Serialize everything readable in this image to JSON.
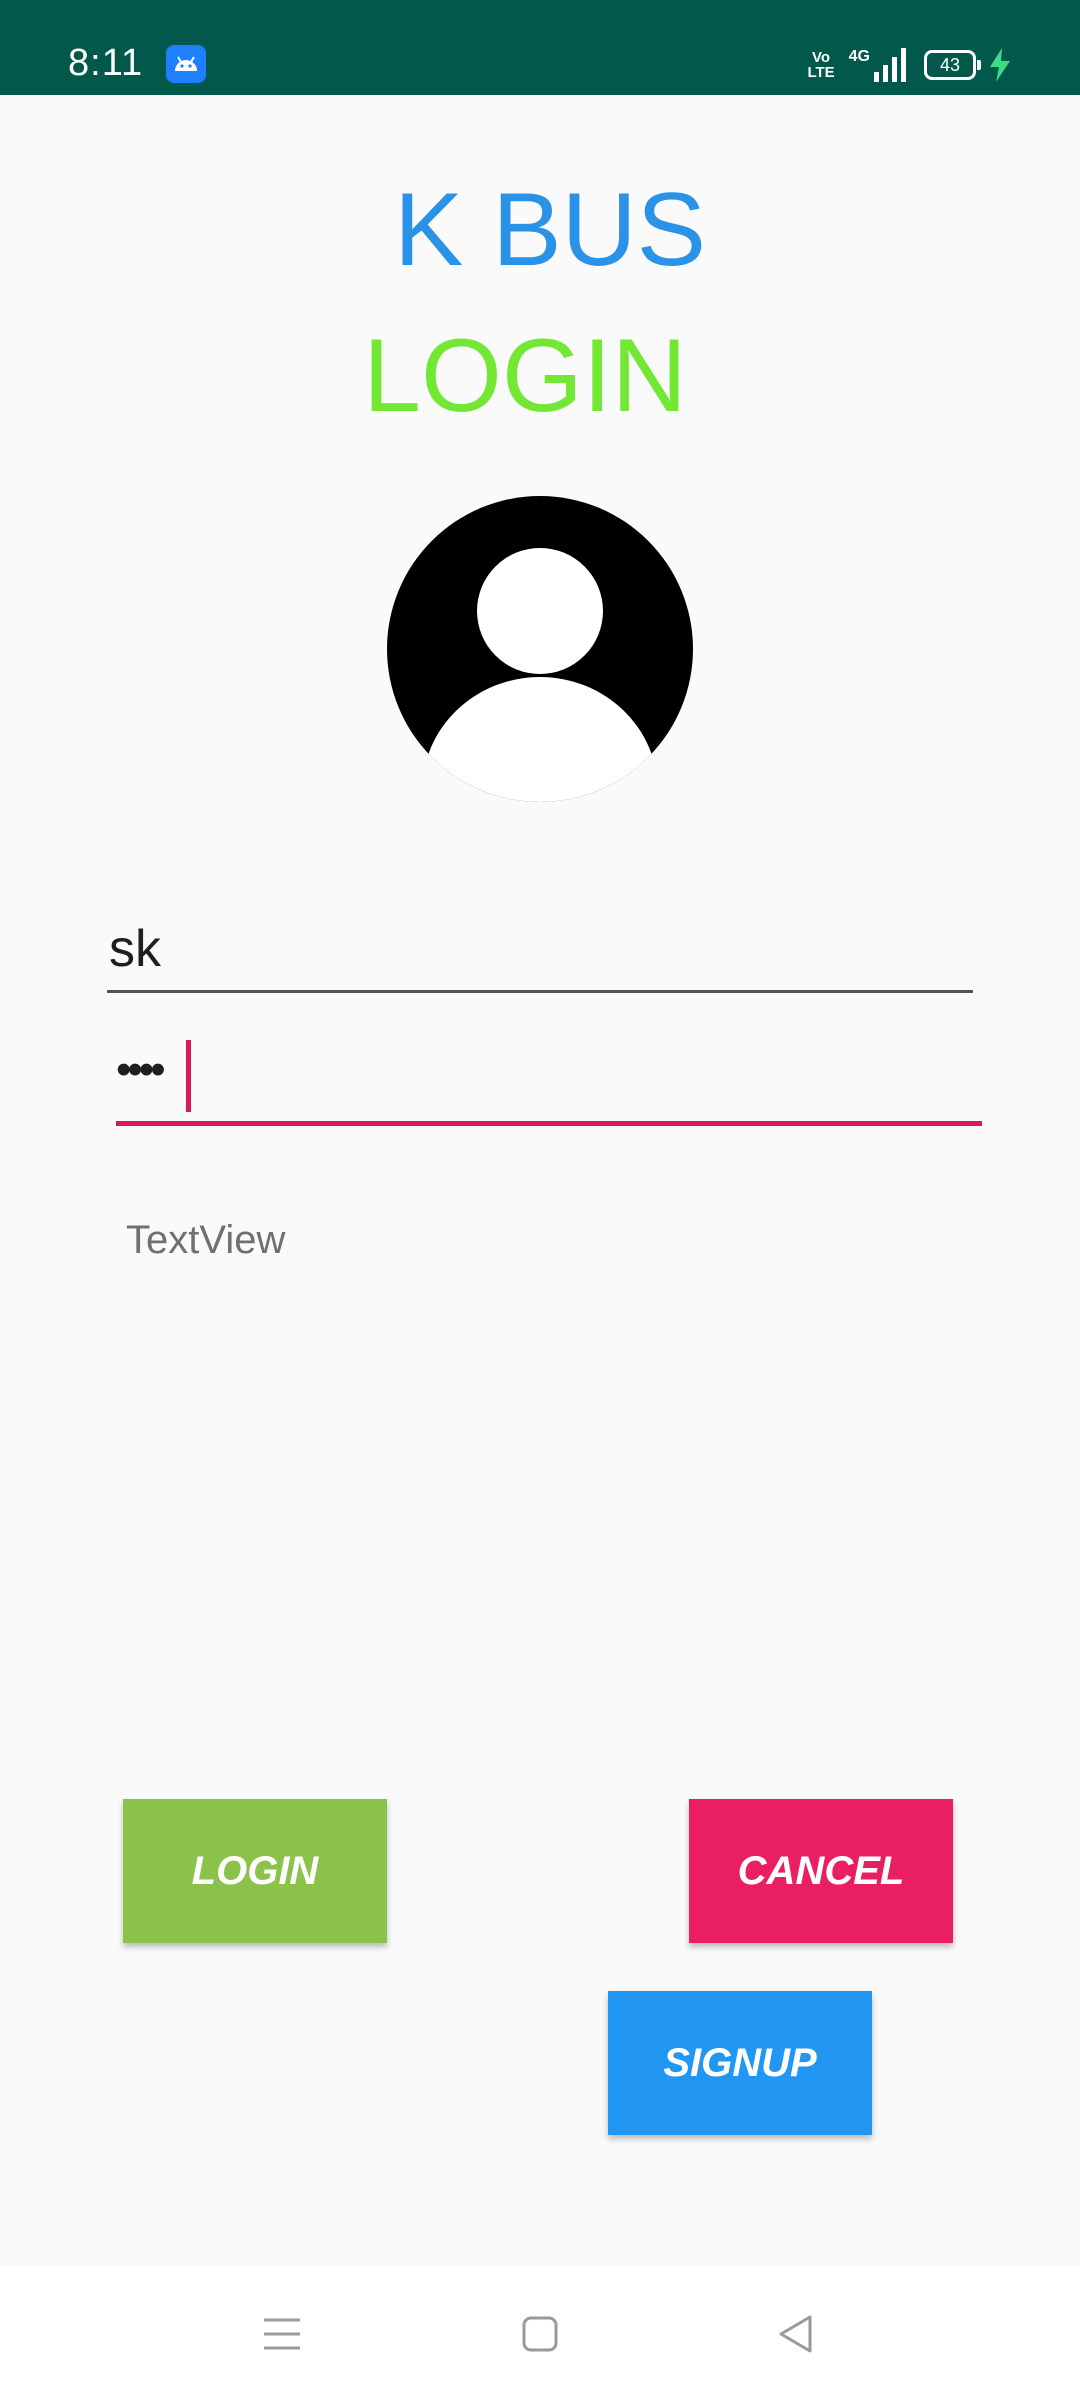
{
  "status_bar": {
    "time": "8:11",
    "volte_top": "Vo",
    "volte_bottom": "LTE",
    "network": "4G",
    "battery": "43",
    "app_icon": "android-icon",
    "signal_icon": "signal-icon",
    "charging_icon": "lightning-icon",
    "bg_color": "#02594B"
  },
  "header": {
    "app_title": "K BUS",
    "screen_title": "LOGIN",
    "title_color": "#2A93E8",
    "subtitle_color": "#72E835"
  },
  "avatar": {
    "icon": "user-avatar-icon"
  },
  "form": {
    "username_value": "sk",
    "password_value": "••••",
    "focus_color": "#D81B60",
    "message": "TextView"
  },
  "buttons": {
    "login": "LOGIN",
    "cancel": "CANCEL",
    "signup": "SIGNUP",
    "login_color": "#8BC34A",
    "cancel_color": "#E91E63",
    "signup_color": "#2196F3"
  },
  "nav_bar": {
    "menu_icon": "menu-icon",
    "home_icon": "home-square-icon",
    "back_icon": "back-triangle-icon"
  }
}
